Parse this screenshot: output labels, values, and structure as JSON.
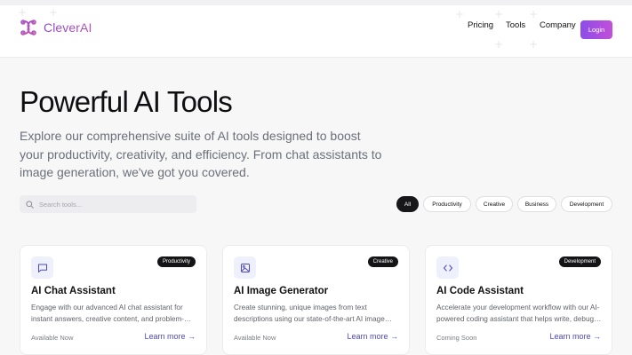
{
  "brand": {
    "name": "CleverAI",
    "accent": "#8b4ee8",
    "accent2": "#c24fd9"
  },
  "nav": {
    "items": [
      {
        "label": "Pricing"
      },
      {
        "label": "Tools"
      },
      {
        "label": "Company"
      }
    ],
    "login_label": "Login"
  },
  "hero": {
    "title": "Powerful AI Tools",
    "subtitle": "Explore our comprehensive suite of AI tools designed to boost your productivity, creativity, and efficiency. From chat assistants to image generation, we've got you covered."
  },
  "search": {
    "placeholder": "Search tools...",
    "icon": "search-icon"
  },
  "filters": [
    {
      "label": "All",
      "active": true
    },
    {
      "label": "Productivity",
      "active": false
    },
    {
      "label": "Creative",
      "active": false
    },
    {
      "label": "Business",
      "active": false
    },
    {
      "label": "Development",
      "active": false
    }
  ],
  "cards": [
    {
      "icon": "chat-icon",
      "badge": "Productivity",
      "title": "AI Chat Assistant",
      "description": "Engage with our advanced AI chat assistant for instant answers, creative content, and problem-solving.",
      "status": "Available Now",
      "link": "Learn more →"
    },
    {
      "icon": "image-icon",
      "badge": "Creative",
      "title": "AI Image Generator",
      "description": "Create stunning, unique images from text descriptions using our state-of-the-art AI image model.",
      "status": "Available Now",
      "link": "Learn more →"
    },
    {
      "icon": "code-icon",
      "badge": "Development",
      "title": "AI Code Assistant",
      "description": "Accelerate your development workflow with our AI-powered coding assistant that helps write, debug and review code.",
      "status": "Coming Soon",
      "link": "Learn more →"
    }
  ]
}
